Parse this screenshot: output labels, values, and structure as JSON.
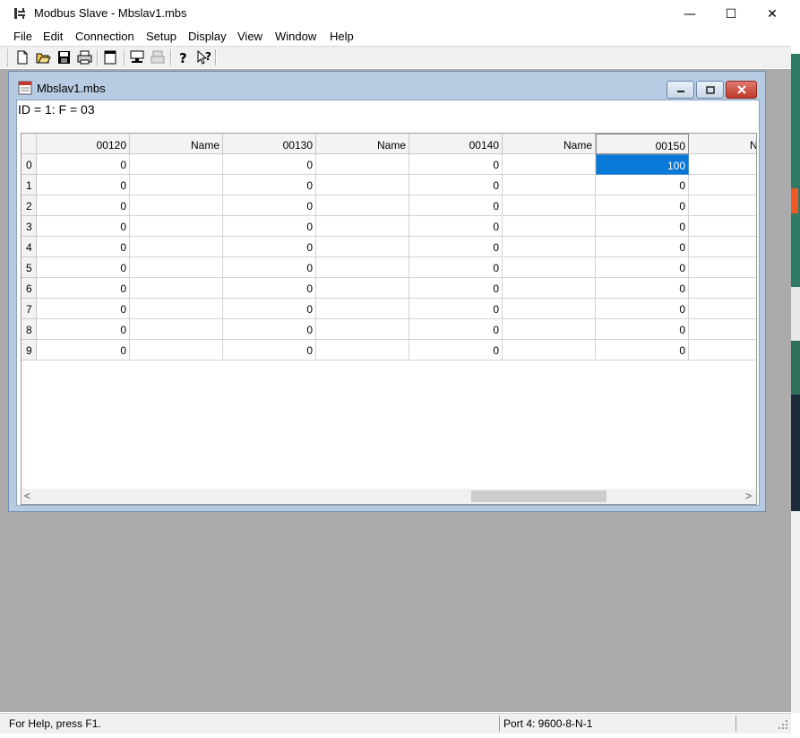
{
  "window": {
    "title": "Modbus Slave - Mbslav1.mbs",
    "controls": {
      "minimize": "—",
      "maximize": "☐",
      "close": "✕"
    }
  },
  "menu": [
    "File",
    "Edit",
    "Connection",
    "Setup",
    "Display",
    "View",
    "Window",
    "Help"
  ],
  "toolbar": {
    "buttons": [
      "new-icon",
      "open-icon",
      "save-icon",
      "print-icon",
      "window-icon",
      "connect-icon",
      "disconnect-icon",
      "help-icon",
      "context-help-icon"
    ]
  },
  "child": {
    "title": "Mbslav1.mbs",
    "id_line": "ID = 1: F = 03"
  },
  "grid": {
    "columns": [
      "00120",
      "Name",
      "00130",
      "Name",
      "00140",
      "Name",
      "00150",
      "Name"
    ],
    "rows": [
      {
        "label": "0",
        "values": [
          "0",
          "",
          "0",
          "",
          "0",
          "",
          "100"
        ]
      },
      {
        "label": "1",
        "values": [
          "0",
          "",
          "0",
          "",
          "0",
          "",
          "0"
        ]
      },
      {
        "label": "2",
        "values": [
          "0",
          "",
          "0",
          "",
          "0",
          "",
          "0"
        ]
      },
      {
        "label": "3",
        "values": [
          "0",
          "",
          "0",
          "",
          "0",
          "",
          "0"
        ]
      },
      {
        "label": "4",
        "values": [
          "0",
          "",
          "0",
          "",
          "0",
          "",
          "0"
        ]
      },
      {
        "label": "5",
        "values": [
          "0",
          "",
          "0",
          "",
          "0",
          "",
          "0"
        ]
      },
      {
        "label": "6",
        "values": [
          "0",
          "",
          "0",
          "",
          "0",
          "",
          "0"
        ]
      },
      {
        "label": "7",
        "values": [
          "0",
          "",
          "0",
          "",
          "0",
          "",
          "0"
        ]
      },
      {
        "label": "8",
        "values": [
          "0",
          "",
          "0",
          "",
          "0",
          "",
          "0"
        ]
      },
      {
        "label": "9",
        "values": [
          "0",
          "",
          "0",
          "",
          "0",
          "",
          "0"
        ]
      }
    ],
    "selected": {
      "row": 0,
      "col": 6
    }
  },
  "scrollbar": {
    "left_arrow": "<",
    "right_arrow": ">"
  },
  "status": {
    "help": "For Help, press F1.",
    "port": "Port 4: 9600-8-N-1"
  },
  "colors": {
    "selection": "#0a78d7",
    "mdi_background": "#ababab",
    "child_frame": "#b7cbe2"
  }
}
